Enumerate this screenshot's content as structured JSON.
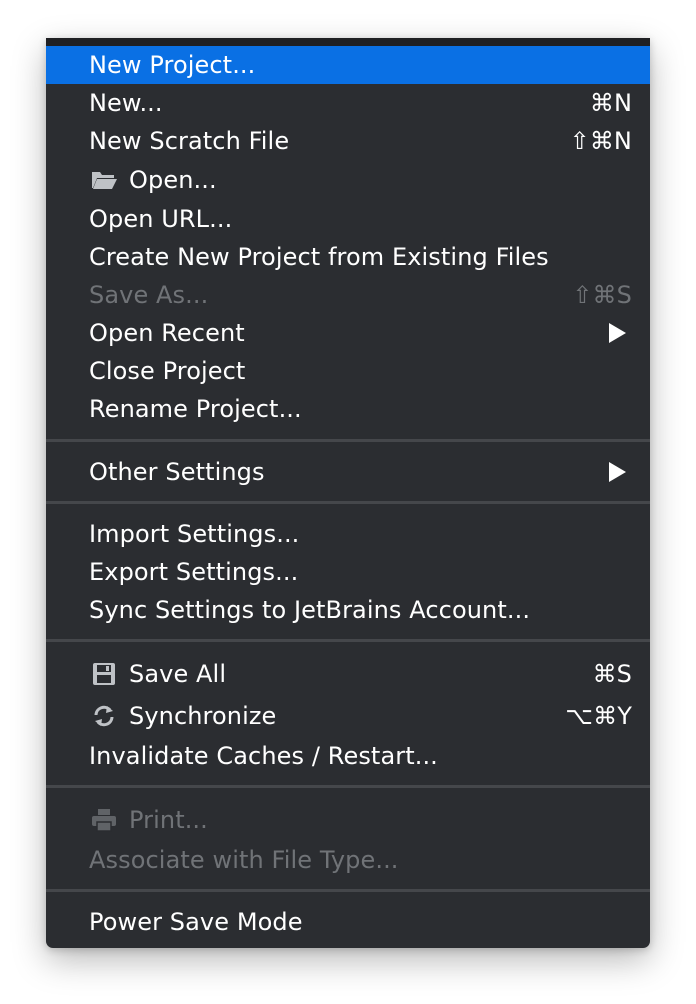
{
  "menu": {
    "items": [
      {
        "label": "New Project...",
        "shortcut": "",
        "highlighted": true
      },
      {
        "label": "New...",
        "shortcut": "⌘N"
      },
      {
        "label": "New Scratch File",
        "shortcut": "⇧⌘N"
      },
      {
        "label": "Open...",
        "icon": "folder-open-icon"
      },
      {
        "label": "Open URL..."
      },
      {
        "label": "Create New Project from Existing Files"
      },
      {
        "label": "Save As...",
        "shortcut": "⇧⌘S",
        "disabled": true
      },
      {
        "label": "Open Recent",
        "submenu": true
      },
      {
        "label": "Close Project"
      },
      {
        "label": "Rename Project..."
      },
      {
        "label": "Other Settings",
        "submenu": true
      },
      {
        "label": "Import Settings..."
      },
      {
        "label": "Export Settings..."
      },
      {
        "label": "Sync Settings to JetBrains Account..."
      },
      {
        "label": "Save All",
        "shortcut": "⌘S",
        "icon": "floppy-disk-icon"
      },
      {
        "label": "Synchronize",
        "shortcut": "⌥⌘Y",
        "icon": "sync-icon"
      },
      {
        "label": "Invalidate Caches / Restart..."
      },
      {
        "label": "Print...",
        "icon": "printer-icon",
        "disabled": true
      },
      {
        "label": "Associate with File Type...",
        "disabled": true
      },
      {
        "label": "Power Save Mode"
      }
    ]
  },
  "colors": {
    "menu_background": "#2b2d31",
    "highlight": "#0a70e4",
    "separator": "#45474b",
    "text": "#ffffff",
    "disabled_text": "#707377"
  }
}
